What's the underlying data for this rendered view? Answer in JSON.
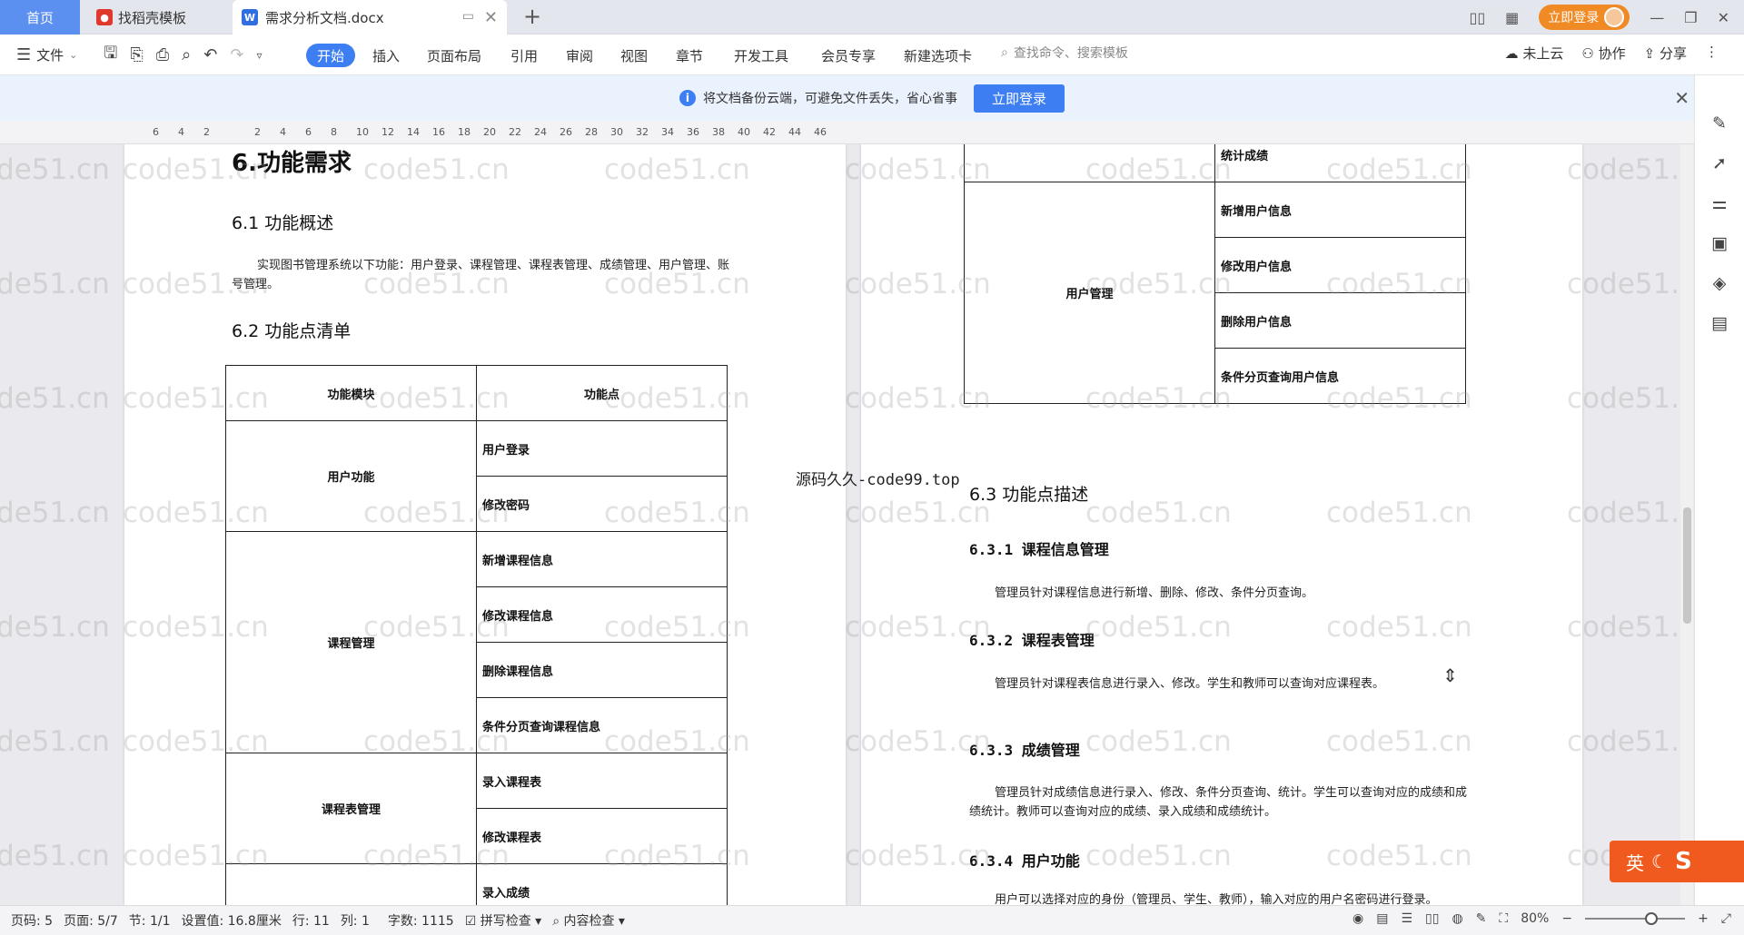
{
  "tabs": {
    "home": "首页",
    "daoke": "找稻壳模板",
    "doc": "需求分析文档.docx"
  },
  "window": {
    "login_pill": "立即登录"
  },
  "toolbar": {
    "file": "文件",
    "ribbon": [
      "开始",
      "插入",
      "页面布局",
      "引用",
      "审阅",
      "视图",
      "章节",
      "开发工具",
      "会员专享",
      "新建选项卡"
    ],
    "search_placeholder": "查找命令、搜索模板",
    "right": [
      "未上云",
      "协作",
      "分享"
    ]
  },
  "notice": {
    "text": "将文档备份云端，可避免文件丢失，省心省事",
    "button": "立即登录"
  },
  "ruler": [
    "6",
    "4",
    "2",
    "",
    "2",
    "4",
    "6",
    "8",
    "10",
    "12",
    "14",
    "16",
    "18",
    "20",
    "22",
    "24",
    "26",
    "28",
    "30",
    "32",
    "34",
    "36",
    "38",
    "40",
    "42",
    "44",
    "46"
  ],
  "page1": {
    "h1": "6.功能需求",
    "h2a": "6.1  功能概述",
    "body": "实现图书管理系统以下功能：用户登录、课程管理、课程表管理、成绩管理、用户管理、账号管理。",
    "h2b": "6.2  功能点清单",
    "table": {
      "header": [
        "功能模块",
        "功能点"
      ],
      "groups": [
        {
          "module": "用户功能",
          "items": [
            "用户登录",
            "修改密码"
          ]
        },
        {
          "module": "课程管理",
          "items": [
            "新增课程信息",
            "修改课程信息",
            "删除课程信息",
            "条件分页查询课程信息"
          ]
        },
        {
          "module": "课程表管理",
          "items": [
            "录入课程表",
            "修改课程表"
          ]
        },
        {
          "module": "",
          "items": [
            "录入成绩"
          ]
        }
      ]
    }
  },
  "page2": {
    "table": {
      "top_item": "统计成绩",
      "module": "用户管理",
      "items": [
        "新增用户信息",
        "修改用户信息",
        "删除用户信息",
        "条件分页查询用户信息"
      ]
    },
    "h2": "6.3  功能点描述",
    "s1_title": "6.3.1 课程信息管理",
    "s1_body": "管理员针对课程信息进行新增、删除、修改、条件分页查询。",
    "s2_title": "6.3.2 课程表管理",
    "s2_body": "管理员针对课程表信息进行录入、修改。学生和教师可以查询对应课程表。",
    "s3_title": "6.3.3 成绩管理",
    "s3_body": "管理员针对成绩信息进行录入、修改、条件分页查询、统计。学生可以查询对应的成绩和成绩统计。教师可以查询对应的成绩、录入成绩和成绩统计。",
    "s4_title": "6.3.4 用户功能",
    "s4_body": "用户可以选择对应的身份（管理员、学生、教师），输入对应的用户名密码进行登录。"
  },
  "overlay": "源码久久-code99.top",
  "watermark": "code51.cn",
  "ime": "英",
  "status": {
    "page_code": "页码: 5",
    "page": "页面: 5/7",
    "section": "节: 1/1",
    "setting": "设置值: 16.8厘米",
    "row": "行: 11",
    "col": "列: 1",
    "words": "字数: 1115",
    "spell": "拼写检查",
    "content": "内容检查",
    "zoom": "80%"
  }
}
